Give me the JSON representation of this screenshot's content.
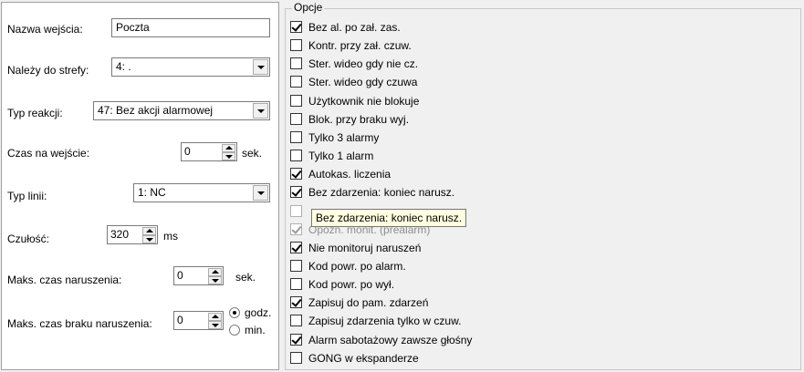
{
  "left": {
    "name_label": "Nazwa wejścia:",
    "name_value": "Poczta",
    "zone_label": "Należy do strefy:",
    "zone_value": "4: .",
    "reaction_label": "Typ reakcji:",
    "reaction_value": "47: Bez akcji alarmowej",
    "entry_time_label": "Czas na wejście:",
    "entry_time_value": "0",
    "entry_time_unit": "sek.",
    "line_type_label": "Typ linii:",
    "line_type_value": "1: NC",
    "sensitivity_label": "Czułość:",
    "sensitivity_value": "320",
    "sensitivity_unit": "ms",
    "max_violation_label": "Maks. czas naruszenia:",
    "max_violation_value": "0",
    "max_violation_unit": "sek.",
    "max_no_violation_label": "Maks. czas braku naruszenia:",
    "max_no_violation_value": "0",
    "radio_hours": "godz.",
    "radio_minutes": "min."
  },
  "options": {
    "title": "Opcje",
    "items": [
      {
        "label": "Bez al. po zał. zas.",
        "checked": true,
        "dim": false
      },
      {
        "label": "Kontr. przy zał. czuw.",
        "checked": false,
        "dim": false
      },
      {
        "label": "Ster. wideo gdy nie cz.",
        "checked": false,
        "dim": false
      },
      {
        "label": "Ster. wideo gdy czuwa",
        "checked": false,
        "dim": false
      },
      {
        "label": "Użytkownik nie blokuje",
        "checked": false,
        "dim": false
      },
      {
        "label": "Blok. przy braku wyj.",
        "checked": false,
        "dim": false
      },
      {
        "label": "Tylko 3 alarmy",
        "checked": false,
        "dim": false
      },
      {
        "label": "Tylko 1 alarm",
        "checked": false,
        "dim": false
      },
      {
        "label": "Autokas. liczenia",
        "checked": true,
        "dim": false
      },
      {
        "label": "Bez zdarzenia: koniec narusz.",
        "checked": true,
        "dim": false
      },
      {
        "label": "",
        "checked": false,
        "dim": true
      },
      {
        "label": "Opóźn. monit. (prealarm)",
        "checked": true,
        "dim": true
      },
      {
        "label": "Nie monitoruj naruszeń",
        "checked": true,
        "dim": false
      },
      {
        "label": "Kod powr. po alarm.",
        "checked": false,
        "dim": false
      },
      {
        "label": "Kod powr. po wył.",
        "checked": false,
        "dim": false
      },
      {
        "label": "Zapisuj do pam. zdarzeń",
        "checked": true,
        "dim": false
      },
      {
        "label": "Zapisuj zdarzenia tylko w czuw.",
        "checked": false,
        "dim": false
      },
      {
        "label": "Alarm sabotażowy zawsze głośny",
        "checked": true,
        "dim": false
      },
      {
        "label": "GONG w ekspanderze",
        "checked": false,
        "dim": false
      }
    ]
  },
  "tooltip": "Bez zdarzenia: koniec narusz."
}
